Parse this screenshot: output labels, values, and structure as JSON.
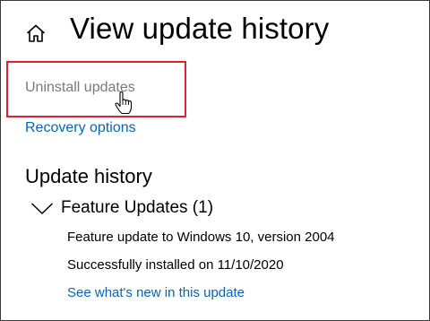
{
  "header": {
    "home_icon": "home-icon",
    "title": "View update history"
  },
  "links": {
    "uninstall": "Uninstall updates",
    "recovery": "Recovery options"
  },
  "colors": {
    "highlight": "#e0212b",
    "link": "#0067c0",
    "muted_link": "#7a7a7a"
  },
  "history": {
    "heading": "Update history",
    "groups": [
      {
        "label": "Feature Updates (1)",
        "expanded": true,
        "items": [
          {
            "name": "Feature update to Windows 10, version 2004",
            "status": "Successfully installed on 11/10/2020",
            "link": "See what's new in this update"
          }
        ]
      }
    ]
  }
}
